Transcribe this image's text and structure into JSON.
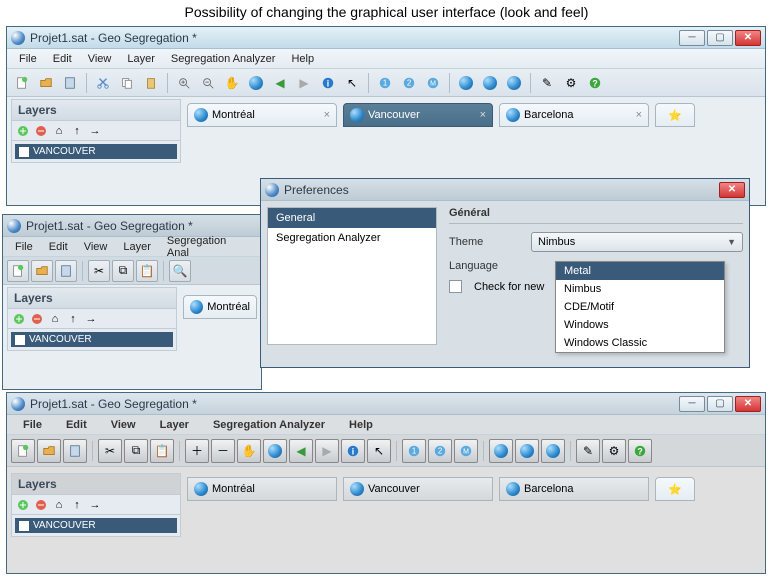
{
  "caption": "Possibility of changing the graphical user interface (look and feel)",
  "window_title": "Projet1.sat - Geo Segregation *",
  "menu": {
    "file": "File",
    "edit": "Edit",
    "view": "View",
    "layer": "Layer",
    "analyzer": "Segregation Analyzer",
    "help": "Help"
  },
  "layers": {
    "title": "Layers",
    "item": "VANCOUVER"
  },
  "tabs": {
    "t1": "Montréal",
    "t2": "Vancouver",
    "t3": "Barcelona"
  },
  "prefs": {
    "title": "Preferences",
    "nav1": "General",
    "nav2": "Segregation Analyzer",
    "header": "Général",
    "theme_label": "Theme",
    "theme_value": "Nimbus",
    "lang_label": "Language",
    "check_label": "Check for new",
    "options": {
      "o1": "Metal",
      "o2": "Nimbus",
      "o3": "CDE/Motif",
      "o4": "Windows",
      "o5": "Windows Classic"
    }
  },
  "metal_menu": {
    "analyzer": "Segregation Anal"
  }
}
